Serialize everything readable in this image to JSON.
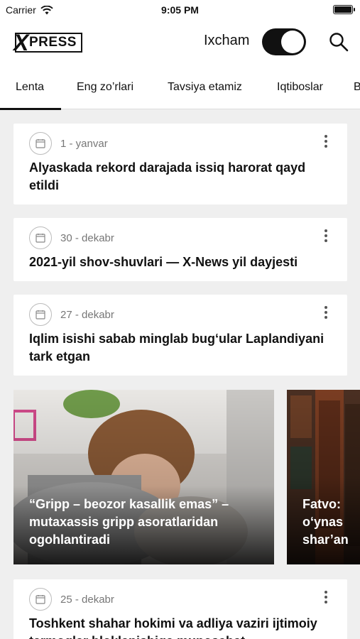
{
  "status_bar": {
    "carrier": "Carrier",
    "time": "9:05 PM"
  },
  "header": {
    "logo_text": "PRESS",
    "logo_x": "X",
    "compact_label": "Ixcham",
    "compact_on": true
  },
  "tabs": [
    "Lenta",
    "Eng zo’rlari",
    "Tavsiya etamiz",
    "Iqtiboslar",
    "B"
  ],
  "active_tab": "Lenta",
  "articles": [
    {
      "date": "1 - yanvar",
      "title": "Alyaskada rekord darajada issiq harorat qayd etildi"
    },
    {
      "date": "30 - dekabr",
      "title": "2021-yil shov-shuvlari — X-News yil dayjesti"
    },
    {
      "date": "27 - dekabr",
      "title": "Iqlim isishi sabab minglab bug‘ular Laplandiyani tark etgan"
    }
  ],
  "featured": [
    {
      "title": "“Gripp – beozor kasallik emas” – mutaxassis gripp asoratlaridan ogohlantiradi"
    },
    {
      "title": "Fatvo:\no‘ynas\nshar’an"
    }
  ],
  "more_articles": [
    {
      "date": "25 - dekabr",
      "title": "Toshkent shahar hokimi va adliya vaziri ijtimoiy tarmoqlar bloklanishiga munosabat"
    }
  ],
  "colors": {
    "accent": "#111111",
    "background": "#efefef",
    "card": "#ffffff",
    "meta": "#777777"
  }
}
